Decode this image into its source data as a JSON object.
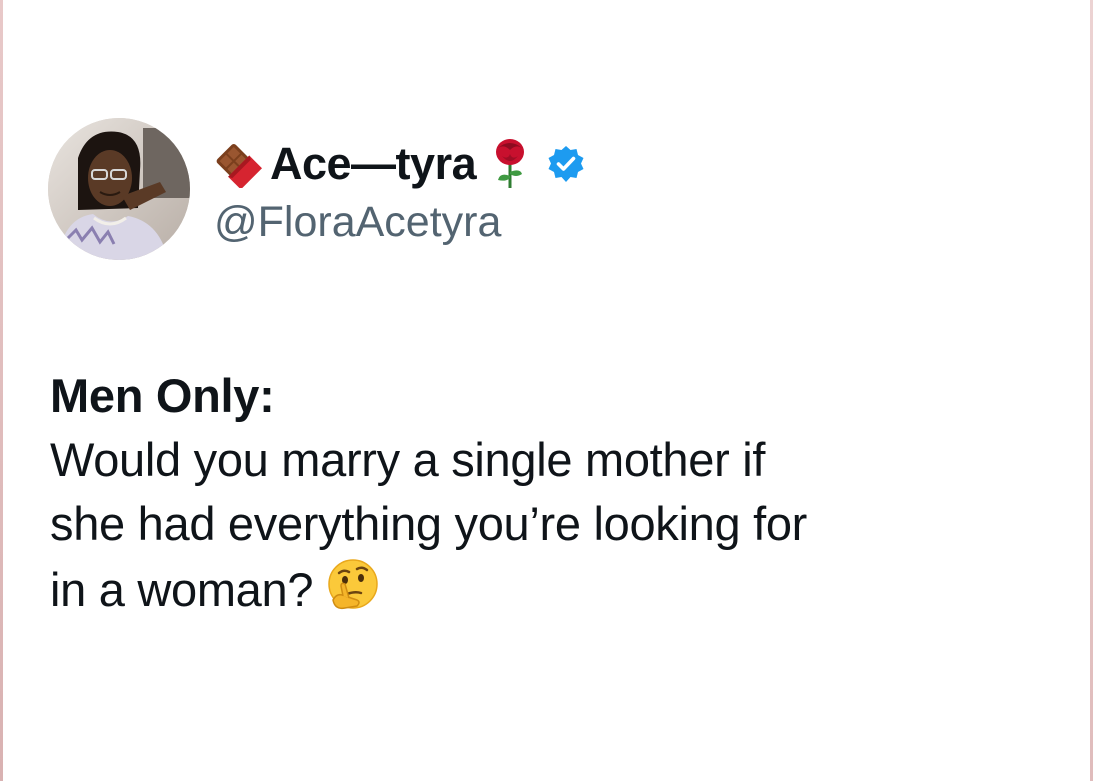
{
  "tweet": {
    "author": {
      "display_name": "Ace—tyra",
      "handle": "@FloraAcetyra",
      "prefix_emoji_name": "chocolate-bar-icon",
      "suffix_emoji_name": "rose-icon",
      "verified_badge": "verified-badge-icon",
      "verified_color": "#1d9bf0"
    },
    "heading": "Men Only:",
    "lines": [
      "Would you marry a single mother if",
      "she had everything you’re looking for",
      "in a woman?"
    ],
    "end_emoji_name": "thinking-face-icon"
  },
  "colors": {
    "text": "#0f1419",
    "handle": "#536471",
    "background": "#ffffff"
  }
}
